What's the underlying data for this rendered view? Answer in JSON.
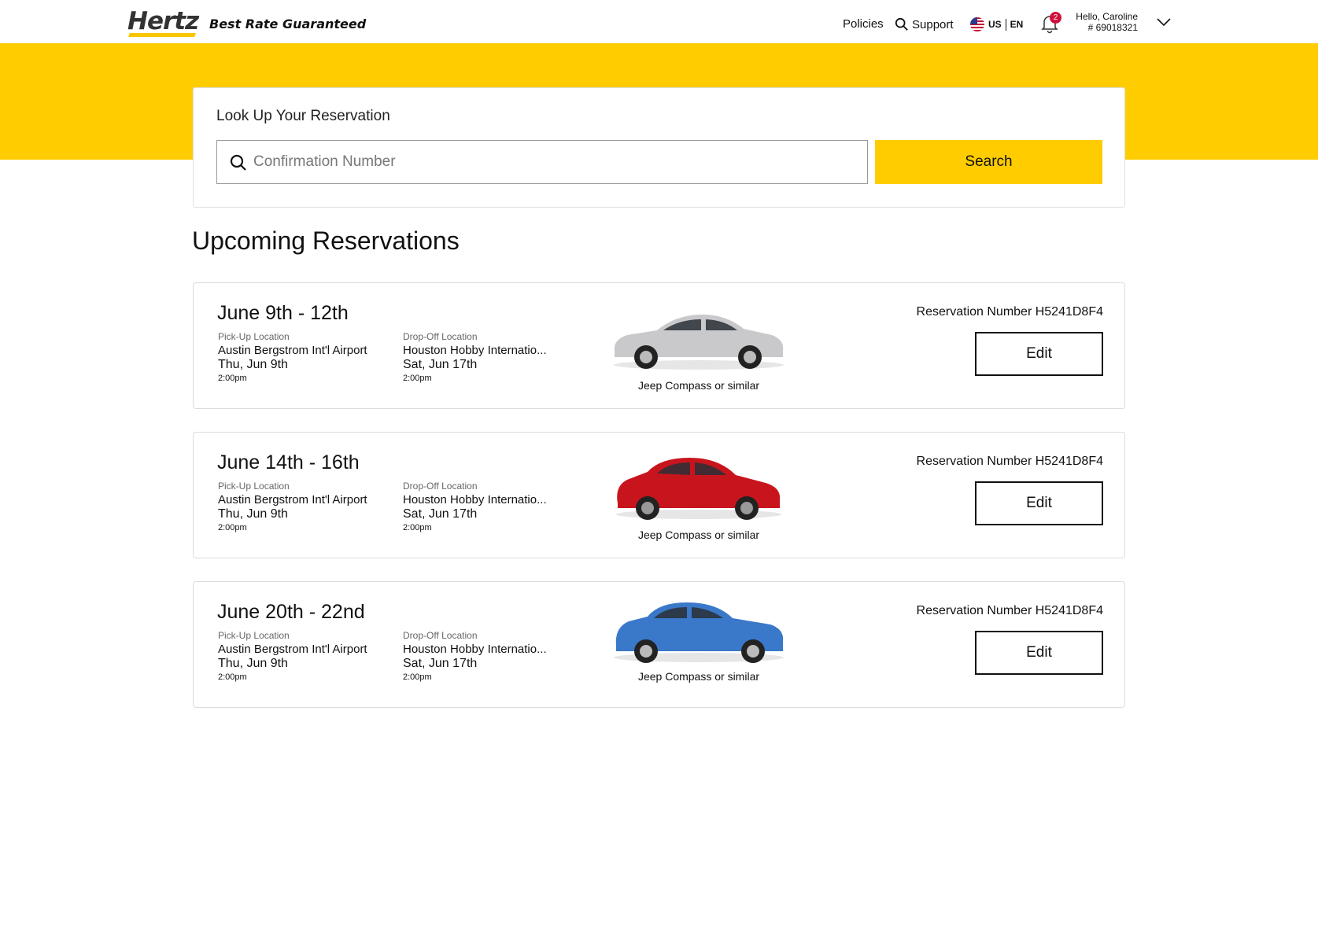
{
  "header": {
    "logo_text": "Hertz",
    "tagline": "Best Rate Guaranteed",
    "nav": {
      "policies": "Policies",
      "support": "Support"
    },
    "lang": {
      "country": "US",
      "language": "EN"
    },
    "notifications_count": "2",
    "user": {
      "greeting": "Hello, Caroline",
      "member_number": "# 69018321"
    }
  },
  "lookup": {
    "title": "Look Up Your Reservation",
    "placeholder": "Confirmation Number",
    "search_label": "Search"
  },
  "section_title": "Upcoming Reservations",
  "reservations": [
    {
      "dates": "June 9th - 12th",
      "pickup_label": "Pick-Up Location",
      "pickup_location": "Austin Bergstrom Int'l Airport",
      "pickup_date": "Thu, Jun 9th",
      "pickup_time": "2:00pm",
      "dropoff_label": "Drop-Off Location",
      "dropoff_location": "Houston Hobby Internatio...",
      "dropoff_date": "Sat, Jun 17th",
      "dropoff_time": "2:00pm",
      "car_caption": "Jeep Compass or similar",
      "car_color": "#c9c9cc",
      "reservation_number": "Reservation Number H5241D8F4",
      "edit_label": "Edit"
    },
    {
      "dates": "June 14th - 16th",
      "pickup_label": "Pick-Up Location",
      "pickup_location": "Austin Bergstrom Int'l Airport",
      "pickup_date": "Thu, Jun 9th",
      "pickup_time": "2:00pm",
      "dropoff_label": "Drop-Off Location",
      "dropoff_location": "Houston Hobby Internatio...",
      "dropoff_date": "Sat, Jun 17th",
      "dropoff_time": "2:00pm",
      "car_caption": "Jeep Compass or similar",
      "car_color": "#c8151d",
      "reservation_number": "Reservation Number H5241D8F4",
      "edit_label": "Edit"
    },
    {
      "dates": "June 20th - 22nd",
      "pickup_label": "Pick-Up Location",
      "pickup_location": "Austin Bergstrom Int'l Airport",
      "pickup_date": "Thu, Jun 9th",
      "pickup_time": "2:00pm",
      "dropoff_label": "Drop-Off Location",
      "dropoff_location": "Houston Hobby Internatio...",
      "dropoff_date": "Sat, Jun 17th",
      "dropoff_time": "2:00pm",
      "car_caption": "Jeep Compass or similar",
      "car_color": "#3a78c9",
      "reservation_number": "Reservation Number H5241D8F4",
      "edit_label": "Edit"
    }
  ],
  "colors": {
    "brand_yellow": "#ffcc00",
    "badge_red": "#d0103a"
  }
}
